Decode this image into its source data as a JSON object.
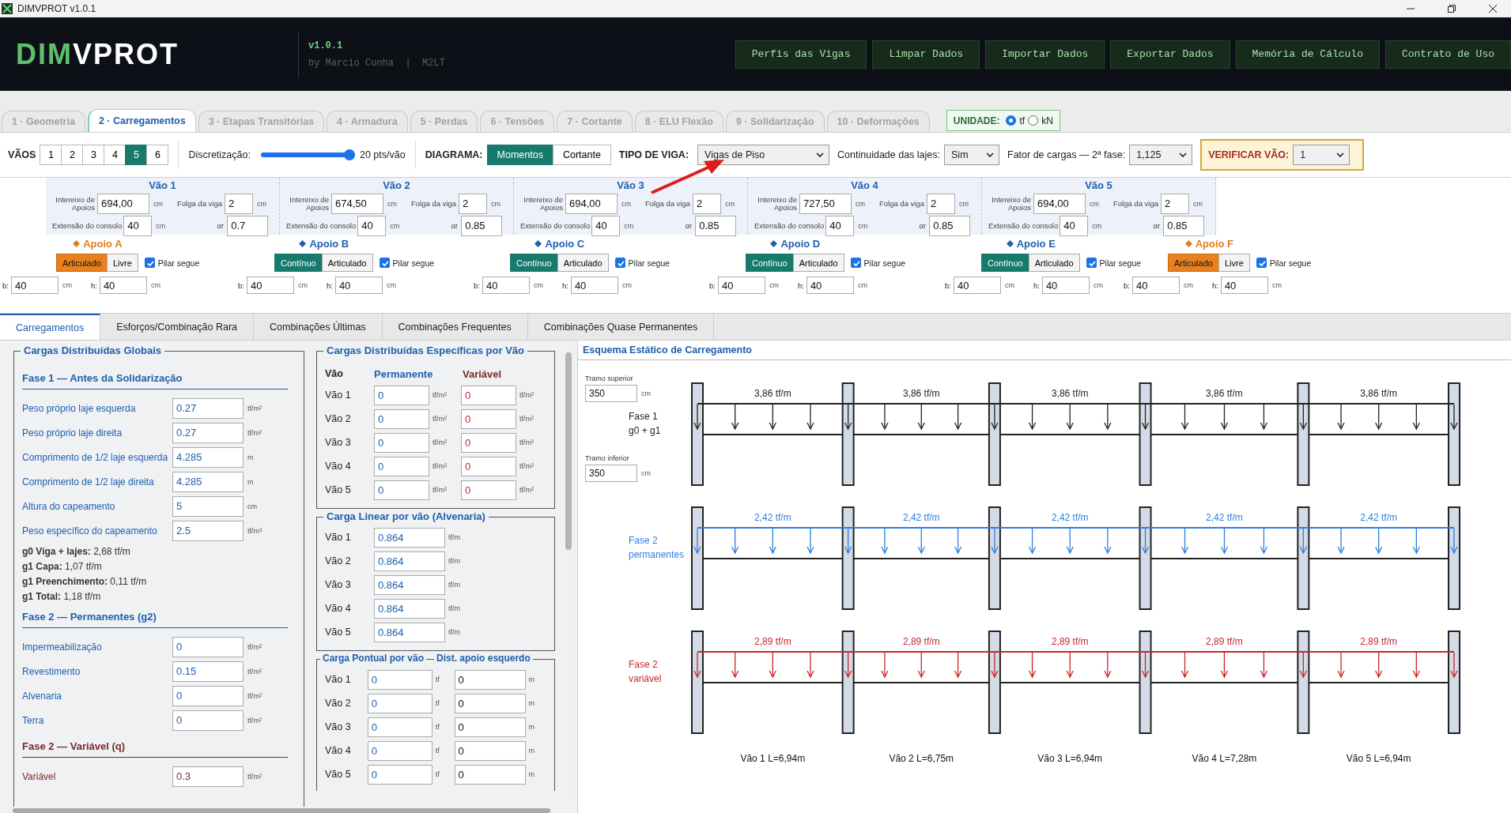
{
  "window": {
    "title": "DIMVPROT v1.0.1"
  },
  "header": {
    "logo_left": "DIM",
    "logo_right": "VPROT",
    "version": "v1.0.1",
    "credits": "by Marcio Cunha  |  M2LT",
    "buttons": [
      "Perfis das Vigas",
      "Limpar Dados",
      "Importar Dados",
      "Exportar Dados",
      "Memória de Cálculo",
      "Contrato de Uso"
    ]
  },
  "tabs": [
    {
      "label": "1 · Geometria",
      "selected": false
    },
    {
      "label": "2 · Carregamentos",
      "selected": true
    },
    {
      "label": "3 · Etapas Transitórias",
      "selected": false
    },
    {
      "label": "4 · Armadura",
      "selected": false
    },
    {
      "label": "5 · Perdas",
      "selected": false
    },
    {
      "label": "6 · Tensões",
      "selected": false
    },
    {
      "label": "7 · Cortante",
      "selected": false
    },
    {
      "label": "8 · ELU Flexão",
      "selected": false
    },
    {
      "label": "9 · Solidarização",
      "selected": false
    },
    {
      "label": "10 · Deformações",
      "selected": false
    }
  ],
  "unit": {
    "label": "UNIDADE:",
    "options": [
      {
        "label": "tf",
        "selected": true
      },
      {
        "label": "kN",
        "selected": false
      }
    ]
  },
  "toolbar": {
    "spans_label": "VÃOS",
    "spans": [
      {
        "label": "1",
        "selected": false
      },
      {
        "label": "2",
        "selected": false
      },
      {
        "label": "3",
        "selected": false
      },
      {
        "label": "4",
        "selected": false
      },
      {
        "label": "5",
        "selected": true
      },
      {
        "label": "6",
        "selected": false
      }
    ],
    "discretization": {
      "label": "Discretização:",
      "level": 1,
      "reading": "20 pts/vão"
    },
    "diagram": {
      "label": "DIAGRAMA:",
      "options": [
        {
          "label": "Momentos",
          "selected": true
        },
        {
          "label": "Cortante",
          "selected": false
        }
      ]
    },
    "beam_type": {
      "label": "TIPO DE VIGA:",
      "value": "Vigas de Piso"
    },
    "slab_continuity": {
      "label": "Continuidade das lajes:",
      "value": "Sim"
    },
    "load_factor": {
      "label": "Fator de cargas — 2ª fase:",
      "value": "1,125"
    },
    "verify_span": {
      "label": "VERIFICAR VÃO:",
      "value": "1"
    }
  },
  "spans": [
    {
      "title": "Vão 1",
      "interaxis_label": "Intereixo de Apoios",
      "interaxis": "694,00",
      "interaxis_unit": "cm",
      "gap_label": "Folga da viga",
      "gap": "2",
      "gap_unit": "cm",
      "console_label": "Extensão do consolo",
      "console": "40",
      "console_unit": "cm",
      "alpha_label": "αr",
      "alpha": "0.7"
    },
    {
      "title": "Vão 2",
      "interaxis_label": "Intereixo de Apoios",
      "interaxis": "674,50",
      "interaxis_unit": "cm",
      "gap_label": "Folga da viga",
      "gap": "2",
      "gap_unit": "cm",
      "console_label": "Extensão do consolo",
      "console": "40",
      "console_unit": "cm",
      "alpha_label": "αr",
      "alpha": "0.85"
    },
    {
      "title": "Vão 3",
      "interaxis_label": "Intereixo de Apoios",
      "interaxis": "694,00",
      "interaxis_unit": "cm",
      "gap_label": "Folga da viga",
      "gap": "2",
      "gap_unit": "cm",
      "console_label": "Extensão do consolo",
      "console": "40",
      "console_unit": "cm",
      "alpha_label": "αr",
      "alpha": "0.85"
    },
    {
      "title": "Vão 4",
      "interaxis_label": "Intereixo de Apoios",
      "interaxis": "727,50",
      "interaxis_unit": "cm",
      "gap_label": "Folga da viga",
      "gap": "2",
      "gap_unit": "cm",
      "console_label": "Extensão do consolo",
      "console": "40",
      "console_unit": "cm",
      "alpha_label": "αr",
      "alpha": "0.85"
    },
    {
      "title": "Vão 5",
      "interaxis_label": "Intereixo de Apoios",
      "interaxis": "694,00",
      "interaxis_unit": "cm",
      "gap_label": "Folga da viga",
      "gap": "2",
      "gap_unit": "cm",
      "console_label": "Extensão do consolo",
      "console": "40",
      "console_unit": "cm",
      "alpha_label": "αr",
      "alpha": "0.85"
    }
  ],
  "supports": [
    {
      "title": "Apoio A",
      "kind": "end",
      "options": [
        {
          "label": "Articulado",
          "selected": true
        },
        {
          "label": "Livre",
          "selected": false
        }
      ],
      "pillar": {
        "label": "Pilar segue",
        "checked": true
      },
      "b_label": "b:",
      "b": "40",
      "b_unit": "cm",
      "h_label": "h:",
      "h": "40",
      "h_unit": "cm"
    },
    {
      "title": "Apoio B",
      "kind": "inner",
      "options": [
        {
          "label": "Contínuo",
          "selected": true
        },
        {
          "label": "Articulado",
          "selected": false
        }
      ],
      "pillar": {
        "label": "Pilar segue",
        "checked": true
      },
      "b_label": "b:",
      "b": "40",
      "b_unit": "cm",
      "h_label": "h:",
      "h": "40",
      "h_unit": "cm"
    },
    {
      "title": "Apoio C",
      "kind": "inner",
      "options": [
        {
          "label": "Contínuo",
          "selected": true
        },
        {
          "label": "Articulado",
          "selected": false
        }
      ],
      "pillar": {
        "label": "Pilar segue",
        "checked": true
      },
      "b_label": "b:",
      "b": "40",
      "b_unit": "cm",
      "h_label": "h:",
      "h": "40",
      "h_unit": "cm"
    },
    {
      "title": "Apoio D",
      "kind": "inner",
      "options": [
        {
          "label": "Contínuo",
          "selected": true
        },
        {
          "label": "Articulado",
          "selected": false
        }
      ],
      "pillar": {
        "label": "Pilar segue",
        "checked": true
      },
      "b_label": "b:",
      "b": "40",
      "b_unit": "cm",
      "h_label": "h:",
      "h": "40",
      "h_unit": "cm"
    },
    {
      "title": "Apoio E",
      "kind": "inner",
      "options": [
        {
          "label": "Contínuo",
          "selected": true
        },
        {
          "label": "Articulado",
          "selected": false
        }
      ],
      "pillar": {
        "label": "Pilar segue",
        "checked": true
      },
      "b_label": "b:",
      "b": "40",
      "b_unit": "cm",
      "h_label": "h:",
      "h": "40",
      "h_unit": "cm"
    },
    {
      "title": "Apoio F",
      "kind": "end",
      "options": [
        {
          "label": "Articulado",
          "selected": true
        },
        {
          "label": "Livre",
          "selected": false
        }
      ],
      "pillar": {
        "label": "Pilar segue",
        "checked": true
      },
      "b_label": "b:",
      "b": "40",
      "b_unit": "cm",
      "h_label": "h:",
      "h": "40",
      "h_unit": "cm"
    }
  ],
  "panel_tabs": [
    {
      "label": "Carregamentos",
      "selected": true
    },
    {
      "label": "Esforços/Combinação Rara",
      "selected": false
    },
    {
      "label": "Combinações Últimas",
      "selected": false
    },
    {
      "label": "Combinações Frequentes",
      "selected": false
    },
    {
      "label": "Combinações Quase Permanentes",
      "selected": false
    }
  ],
  "global_loads": {
    "title": "Cargas Distribuídas Globais",
    "sections": [
      {
        "title": "Fase 1 — Antes da Solidarização",
        "kind": "permanent",
        "fields": [
          {
            "label": "Peso próprio laje esquerda",
            "value": "0.27",
            "unit": "tf/m²"
          },
          {
            "label": "Peso próprio laje direita",
            "value": "0.27",
            "unit": "tf/m²"
          },
          {
            "label": "Comprimento de 1/2 laje esquerda",
            "value": "4.285",
            "unit": "m"
          },
          {
            "label": "Comprimento de 1/2 laje direita",
            "value": "4.285",
            "unit": "m"
          },
          {
            "label": "Altura do capeamento",
            "value": "5",
            "unit": "cm"
          },
          {
            "label": "Peso específico do capeamento",
            "value": "2.5",
            "unit": "tf/m³"
          }
        ],
        "summary": [
          "**g0 Viga + lajes:** 2,68 tf/m",
          "**g1 Capa:** 1,07 tf/m",
          "**g1 Preenchimento:** 0,11 tf/m",
          "**g1 Total:** 1,18 tf/m"
        ]
      },
      {
        "title": "Fase 2 — Permanentes (g2)",
        "kind": "permanent",
        "fields": [
          {
            "label": "Impermeabilização",
            "value": "0",
            "unit": "tf/m²"
          },
          {
            "label": "Revestimento",
            "value": "0.15",
            "unit": "tf/m²"
          },
          {
            "label": "Alvenaria",
            "value": "0",
            "unit": "tf/m²"
          },
          {
            "label": "Terra",
            "value": "0",
            "unit": "tf/m²"
          }
        ]
      },
      {
        "title": "Fase 2 — Variável (q)",
        "kind": "variable",
        "fields": [
          {
            "label": "Variável",
            "value": "0.3",
            "unit": "tf/m²"
          }
        ]
      }
    ]
  },
  "specific_loads": {
    "title": "Cargas Distribuídas Específicas por Vão",
    "headers": [
      "Vão",
      "Permanente",
      "Variável"
    ],
    "rows": [
      {
        "label": "Vão 1",
        "permanent": "0",
        "permanent_unit": "tf/m²",
        "variable": "0",
        "variable_unit": "tf/m²"
      },
      {
        "label": "Vão 2",
        "permanent": "0",
        "permanent_unit": "tf/m²",
        "variable": "0",
        "variable_unit": "tf/m²"
      },
      {
        "label": "Vão 3",
        "permanent": "0",
        "permanent_unit": "tf/m²",
        "variable": "0",
        "variable_unit": "tf/m²"
      },
      {
        "label": "Vão 4",
        "permanent": "0",
        "permanent_unit": "tf/m²",
        "variable": "0",
        "variable_unit": "tf/m²"
      },
      {
        "label": "Vão 5",
        "permanent": "0",
        "permanent_unit": "tf/m²",
        "variable": "0",
        "variable_unit": "tf/m²"
      }
    ]
  },
  "linear_loads": {
    "title": "Carga Linear por vão (Alvenaria)",
    "rows": [
      {
        "label": "Vão 1",
        "value": "0.864",
        "unit": "tf/m"
      },
      {
        "label": "Vão 2",
        "value": "0.864",
        "unit": "tf/m"
      },
      {
        "label": "Vão 3",
        "value": "0.864",
        "unit": "tf/m"
      },
      {
        "label": "Vão 4",
        "value": "0.864",
        "unit": "tf/m"
      },
      {
        "label": "Vão 5",
        "value": "0.864",
        "unit": "tf/m"
      }
    ]
  },
  "point_loads": {
    "title": "Carga Pontual por vão",
    "title_2": "Dist. apoio esquerdo",
    "rows": [
      {
        "label": "Vão 1",
        "load": "0",
        "load_unit": "tf",
        "dist": "0",
        "dist_unit": "m"
      },
      {
        "label": "Vão 2",
        "load": "0",
        "load_unit": "tf",
        "dist": "0",
        "dist_unit": "m"
      },
      {
        "label": "Vão 3",
        "load": "0",
        "load_unit": "tf",
        "dist": "0",
        "dist_unit": "m"
      },
      {
        "label": "Vão 4",
        "load": "0",
        "load_unit": "tf",
        "dist": "0",
        "dist_unit": "m"
      },
      {
        "label": "Vão 5",
        "load": "0",
        "load_unit": "tf",
        "dist": "0",
        "dist_unit": "m"
      }
    ]
  },
  "diagram": {
    "title": "Esquema Estático de Carregamento",
    "upper": {
      "label": "Tramo superior",
      "value": "350",
      "unit": "cm"
    },
    "lower": {
      "label": "Tramo inferior",
      "value": "350",
      "unit": "cm"
    },
    "phases": [
      {
        "label_lines": [
          "Fase 1",
          "g0 + g1"
        ],
        "color": "#222222",
        "loads": [
          "3,86 tf/m",
          "3,86 tf/m",
          "3,86 tf/m",
          "3,86 tf/m",
          "3,86 tf/m"
        ]
      },
      {
        "label_lines": [
          "Fase 2",
          "permanentes"
        ],
        "color": "#2f7de1",
        "loads": [
          "2,42 tf/m",
          "2,42 tf/m",
          "2,42 tf/m",
          "2,42 tf/m",
          "2,42 tf/m"
        ]
      },
      {
        "label_lines": [
          "Fase 2",
          "variável"
        ],
        "color": "#c8262b",
        "loads": [
          "2,89 tf/m",
          "2,89 tf/m",
          "2,89 tf/m",
          "2,89 tf/m",
          "2,89 tf/m"
        ]
      }
    ],
    "span_labels": [
      "Vão 1 L=6,94m",
      "Vão 2 L=6,75m",
      "Vão 3 L=6,94m",
      "Vão 4 L=7,28m",
      "Vão 5 L=6,94m"
    ]
  }
}
